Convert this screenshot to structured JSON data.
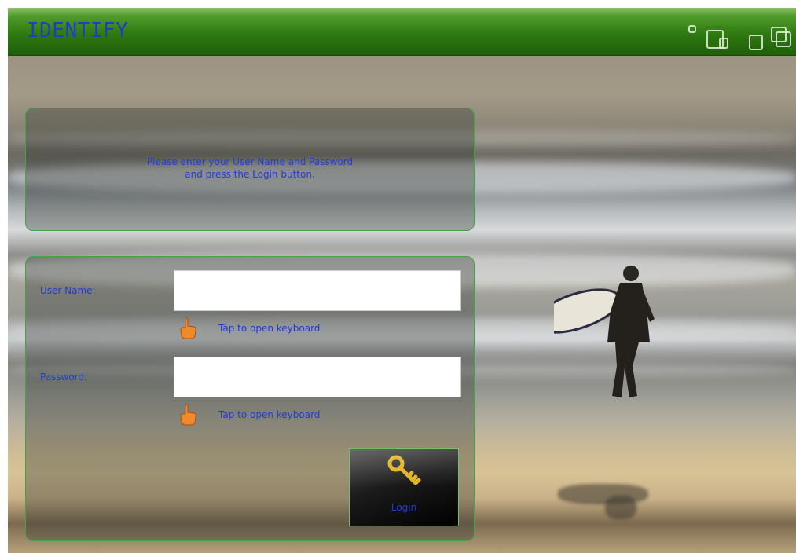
{
  "header": {
    "title": "IDENTIFY",
    "window_icons": [
      "small-square-icon",
      "overlap-squares-icon",
      "square-icon",
      "overlap-squares-icon"
    ],
    "colors": {
      "bar": "#2f7a12",
      "title": "#1f3dc9"
    }
  },
  "instructions": {
    "line1": "Please enter your User Name and Password",
    "line2": "and press the Login button."
  },
  "login_form": {
    "username": {
      "label": "User Name:",
      "value": "",
      "placeholder": ""
    },
    "username_keyboard": {
      "icon": "pointing-hand-icon",
      "label": "Tap to open keyboard"
    },
    "password": {
      "label": "Password:",
      "value": "",
      "placeholder": ""
    },
    "password_keyboard": {
      "icon": "pointing-hand-icon",
      "label": "Tap to open keyboard"
    },
    "login_button": {
      "icon": "key-icon",
      "label": "Login"
    }
  },
  "colors": {
    "text": "#1f3dd9",
    "panel_border": "#3ea83e"
  }
}
